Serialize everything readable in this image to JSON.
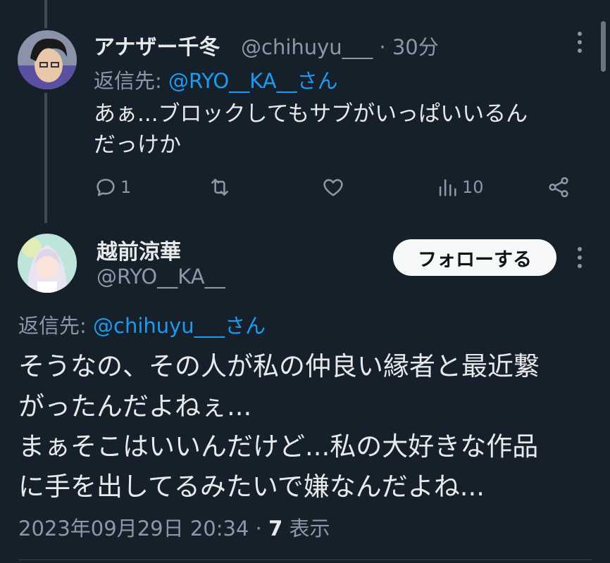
{
  "reply": {
    "display_name": "アナザー千冬",
    "handle": "@chihuyu___",
    "time": "· 30分",
    "replying_prefix": "返信先: ",
    "replying_mention": "@RYO__KA__さん",
    "text_line1": "あぁ...ブロックしてもサブがいっぱいいるん",
    "text_line2": "だっけか",
    "reply_count": "1",
    "retweet_count": "",
    "like_count": "",
    "view_count": "10"
  },
  "main_tweet": {
    "display_name": "越前涼華",
    "handle": "@RYO__KA__",
    "follow_label": "フォローする",
    "replying_prefix": "返信先: ",
    "replying_mention": "@chihuyu___さん",
    "lines": [
      "そうなの、その人が私の仲良い縁者と最近繋",
      "がったんだよねぇ...",
      "まぁそこはいいんだけど...私の大好きな作品",
      "に手を出してるみたいで嫌なんだよね..."
    ],
    "timestamp": "2023年09月29日 20:34 · ",
    "views_number": "7",
    "views_label": " 表示"
  },
  "colors": {
    "background": "#15202b",
    "accent": "#1d9bf0",
    "secondary_text": "#8b98a5"
  }
}
